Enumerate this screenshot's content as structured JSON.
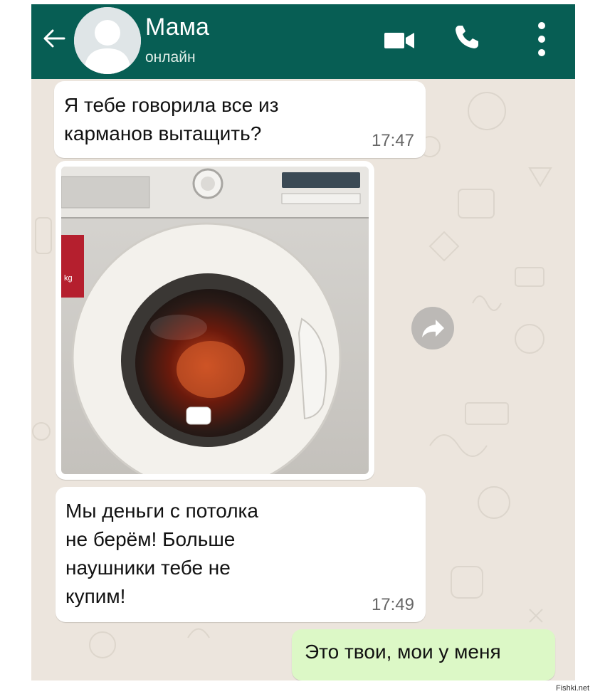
{
  "header": {
    "contact_name": "Мама",
    "status": "онлайн",
    "icons": [
      "back-arrow-icon",
      "avatar-placeholder-icon",
      "video-camera-icon",
      "phone-icon",
      "more-vert-icon"
    ]
  },
  "messages": [
    {
      "direction": "incoming",
      "text": "Я тебе говорила все из\nкарманов вытащить?",
      "time": "17:47"
    },
    {
      "direction": "incoming",
      "type": "image",
      "image_subject": "washing-machine-photo"
    },
    {
      "direction": "incoming",
      "text": "Мы деньги с потолка\nне берём! Больше\nнаушники тебе не\nкупим!",
      "time": "17:49"
    },
    {
      "direction": "outgoing",
      "text": "Это твои, мои у меня"
    }
  ],
  "photo_labels": {
    "drum_kg": "kg"
  },
  "watermark": "Fishki.net",
  "colors": {
    "header": "#075e54",
    "chat_background": "#ece5dd",
    "incoming_bubble": "#ffffff",
    "outgoing_bubble": "#dcf8c6"
  }
}
